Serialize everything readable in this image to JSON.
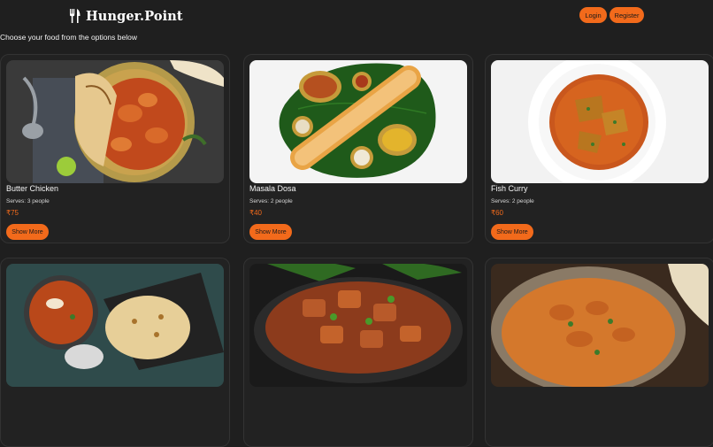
{
  "header": {
    "logo_text": "Hunger.Point",
    "logo_icon": "fork-knife-icon",
    "login_label": "Login",
    "register_label": "Register"
  },
  "subtitle": "Choose your food from the options below",
  "colors": {
    "background": "#1f1f1f",
    "card": "#222222",
    "accent": "#f26a1b",
    "text": "#ffffff"
  },
  "cards": [
    {
      "name": "Butter Chicken",
      "serves": "Serves: 3 people",
      "price": "₹75",
      "button": "Show More"
    },
    {
      "name": "Masala Dosa",
      "serves": "Serves: 2 people",
      "price": "₹40",
      "button": "Show More"
    },
    {
      "name": "Fish Curry",
      "serves": "Serves: 2 people",
      "price": "₹60",
      "button": "Show More"
    }
  ]
}
